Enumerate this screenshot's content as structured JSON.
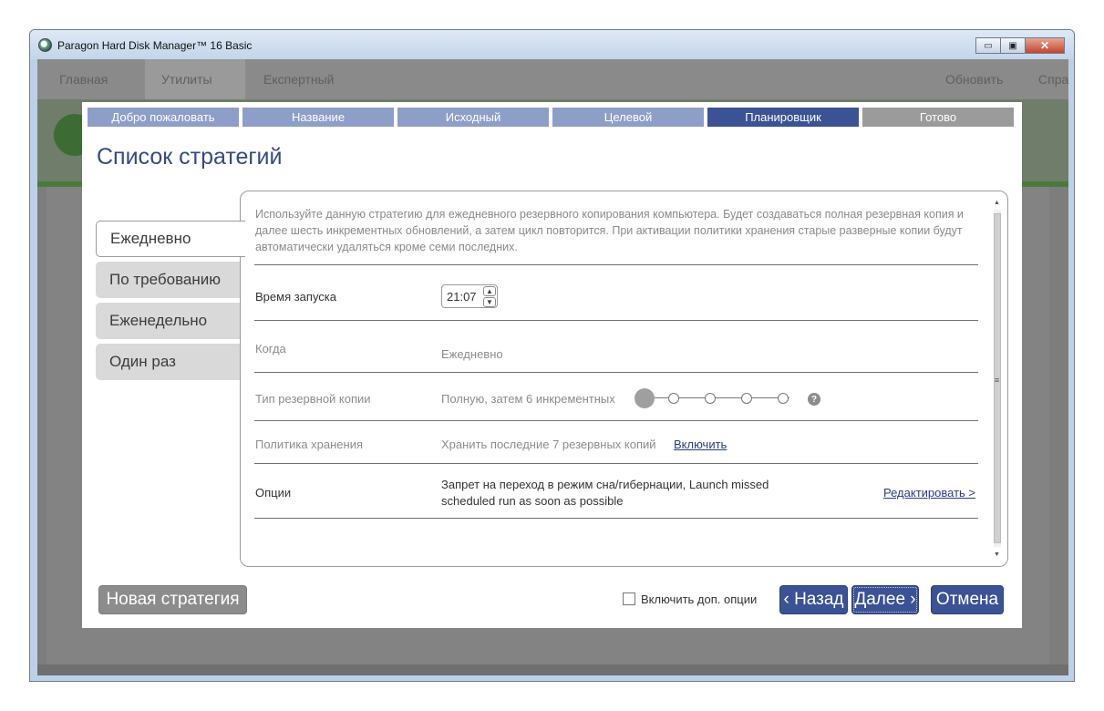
{
  "window": {
    "title": "Paragon Hard Disk Manager™ 16 Basic",
    "minimize_glyph": "▭",
    "maximize_glyph": "▣",
    "close_glyph": "✕"
  },
  "background_app": {
    "menu": [
      "Главная",
      "Утилиты",
      "Експертный",
      "Обновить",
      "Спра"
    ]
  },
  "wizard": {
    "steps": [
      "Добро пожаловать",
      "Название",
      "Исходный",
      "Целевой",
      "Планировщик",
      "Готово"
    ],
    "active_step": "Планировщик",
    "title": "Список стратегий",
    "strategies": [
      "Ежедневно",
      "По требованию",
      "Еженедельно",
      "Один раз"
    ],
    "selected_strategy": "Ежедневно",
    "description": "Используйте данную стратегию для ежедневного резервного копирования компьютера. Будет создаваться полная резервная копия и далее шесть инкрементных обновлений, а затем цикл повторится. При активации политики хранения старые разверные копии будут автоматически удаляться кроме семи последних.",
    "rows": {
      "start_time": {
        "label": "Время запуска",
        "value": "21:07"
      },
      "when": {
        "label": "Когда",
        "value": "Ежедневно"
      },
      "backup_type": {
        "label": "Тип резервной копии",
        "value": "Полную, затем 6 инкрементных",
        "slider_position": 0,
        "slider_steps": 5
      },
      "retention": {
        "label": "Политика хранения",
        "value": "Хранить последние 7 резервных копий",
        "link": "Включить"
      },
      "options": {
        "label": "Опции",
        "value_line1": "Запрет на переход в режим сна/гибернации, Launch missed",
        "value_line2": "scheduled run as soon as possible",
        "link": "Редактировать >"
      }
    },
    "help_glyph": "?",
    "footer": {
      "new_strategy": "Новая стратегия",
      "extra_options_label": "Включить доп. опции",
      "extra_options_checked": false,
      "back": "‹ Назад",
      "next": "Далее ›",
      "cancel": "Отмена"
    }
  },
  "colors": {
    "accent": "#3b5294",
    "step_inactive": "#8d9ec9",
    "step_done": "#9b9b9b",
    "title": "#344a82"
  }
}
